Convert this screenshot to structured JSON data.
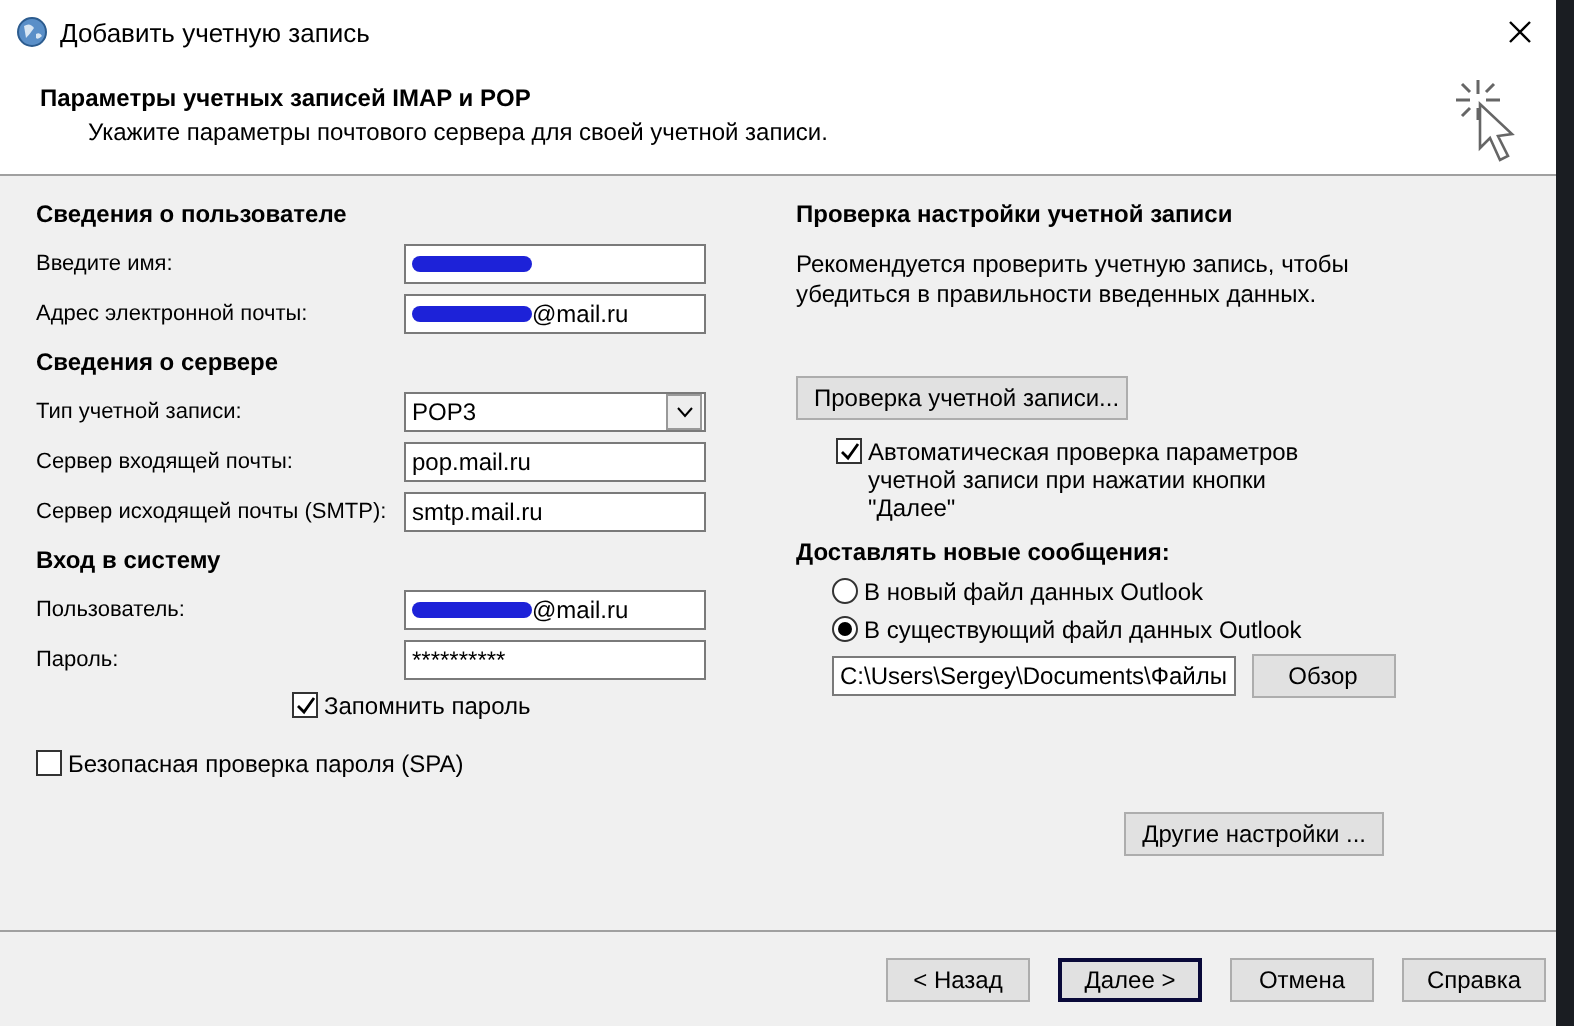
{
  "window": {
    "title": "Добавить учетную запись"
  },
  "header": {
    "title": "Параметры учетных записей IMAP и POP",
    "subtitle": "Укажите параметры почтового сервера для своей учетной записи."
  },
  "left_sections": [
    {
      "heading": "Сведения о пользователе",
      "rows": [
        {
          "kind": "text",
          "label": "Введите имя:",
          "redacted": true
        },
        {
          "kind": "text",
          "label": "Адрес электронной почты:",
          "value": "@mail.ru",
          "redacted": true
        }
      ]
    },
    {
      "heading": "Сведения о сервере",
      "rows": [
        {
          "kind": "select",
          "label": "Тип учетной записи:",
          "value": "POP3"
        },
        {
          "kind": "text",
          "label": "Сервер входящей почты:",
          "value": "pop.mail.ru"
        },
        {
          "kind": "text",
          "label": "Сервер исходящей почты (SMTP):",
          "value": "smtp.mail.ru"
        }
      ]
    },
    {
      "heading": "Вход в систему",
      "rows": [
        {
          "kind": "text",
          "label": "Пользователь:",
          "value": "@mail.ru",
          "redacted": true
        },
        {
          "kind": "password",
          "label": "Пароль:",
          "value": "**********"
        }
      ]
    }
  ],
  "remember_password": {
    "label": "Запомнить пароль",
    "checked": true
  },
  "spa": {
    "label": "Безопасная проверка пароля (SPA)",
    "checked": false
  },
  "test": {
    "heading": "Проверка настройки учетной записи",
    "text": "Рекомендуется проверить учетную запись, чтобы убедиться в правильности введенных данных.",
    "button": "Проверка учетной записи...",
    "auto_check": {
      "label": "Автоматическая проверка параметров учетной записи при нажатии кнопки \"Далее\"",
      "checked": true
    }
  },
  "deliver": {
    "heading": "Доставлять новые сообщения:",
    "options": [
      {
        "label": "В новый файл данных Outlook",
        "selected": false
      },
      {
        "label": "В существующий файл данных Outlook",
        "selected": true
      }
    ],
    "path": "C:\\Users\\Sergey\\Documents\\Файлы",
    "browse": "Обзор"
  },
  "more_settings": "Другие настройки ...",
  "buttons": [
    {
      "label": "< Назад",
      "default": false
    },
    {
      "label": "Далее >",
      "default": true
    },
    {
      "label": "Отмена",
      "default": false
    },
    {
      "label": "Справка",
      "default": false
    }
  ]
}
